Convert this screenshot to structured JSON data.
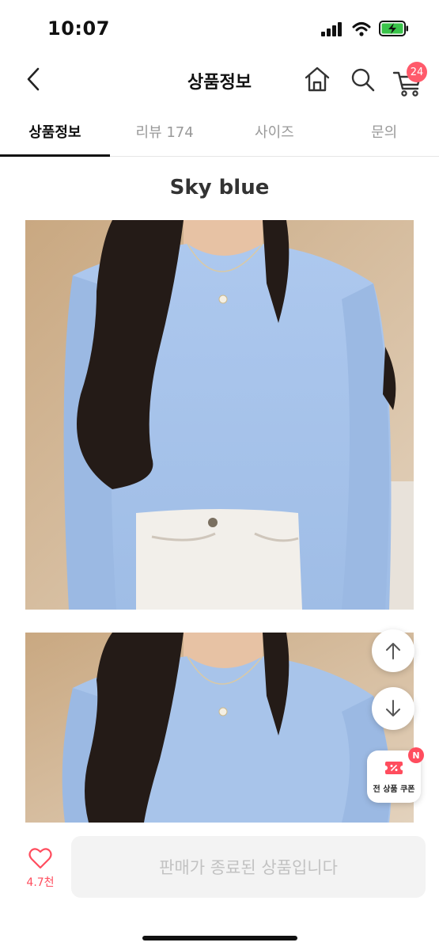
{
  "status_bar": {
    "time": "10:07"
  },
  "header": {
    "title": "상품정보",
    "cart_count": "24"
  },
  "tabs": [
    {
      "label": "상품정보",
      "active": true
    },
    {
      "label": "리뷰 174",
      "active": false
    },
    {
      "label": "사이즈",
      "active": false
    },
    {
      "label": "문의",
      "active": false
    }
  ],
  "content": {
    "color_heading": "Sky blue"
  },
  "floating": {
    "coupon_label": "전 상품 쿠폰",
    "new_badge": "N"
  },
  "bottom_bar": {
    "like_count": "4.7천",
    "status_label": "판매가 종료된 상품입니다"
  },
  "colors": {
    "accent": "#ff4d5e",
    "sweater": "#a8c4ea",
    "background": "#ffffff"
  },
  "icons": [
    "back-icon",
    "home-icon",
    "search-icon",
    "cart-icon",
    "arrow-up-icon",
    "arrow-down-icon",
    "coupon-icon",
    "heart-icon"
  ]
}
